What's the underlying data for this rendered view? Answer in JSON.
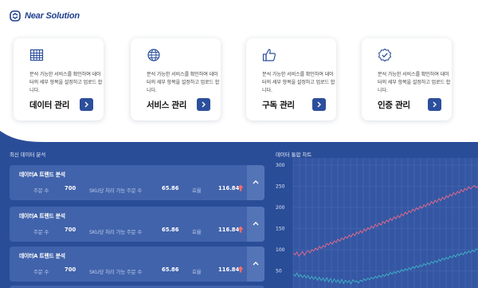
{
  "brand": {
    "name": "Near Solution",
    "color": "#1f3e8f"
  },
  "cards": [
    {
      "icon": "grid-table-icon",
      "description": "분석 가능한 서비스를 확인하여 데이터의 세부 항목을 설정하고 업로드 합니다.",
      "title": "데이터 관리"
    },
    {
      "icon": "globe-icon",
      "description": "분석 가능한 서비스를 확인하여 데이터의 세부 항목을 설정하고 업로드 합니다.",
      "title": "서비스 관리"
    },
    {
      "icon": "thumbs-up-icon",
      "description": "분석 가능한 서비스를 확인하여 데이터의 세부 항목을 설정하고 업로드 합니다.",
      "title": "구독 관리"
    },
    {
      "icon": "badge-check-icon",
      "description": "분석 가능한 서비스를 확인하여 데이터의 세부 항목을 설정하고 업로드 합니다.",
      "title": "인증 관리"
    }
  ],
  "recent": {
    "title": "최신 데이터 분석",
    "rows": [
      {
        "title": "데이터A 트렌드 분석",
        "orders_label": "주문 수",
        "orders": "700",
        "sku_label": "SKU당 처리 가능 주문 수",
        "sku": "65.86",
        "eff_label": "효율",
        "eff": "116.84",
        "trend": "up"
      },
      {
        "title": "데이터A 트렌드 분석",
        "orders_label": "주문 수",
        "orders": "700",
        "sku_label": "SKU당 처리 가능 주문 수",
        "sku": "65.86",
        "eff_label": "효율",
        "eff": "116.84",
        "trend": "up"
      },
      {
        "title": "데이터A 트렌드 분석",
        "orders_label": "주문 수",
        "orders": "700",
        "sku_label": "SKU당 처리 가능 주문 수",
        "sku": "65.86",
        "eff_label": "효율",
        "eff": "116.84",
        "trend": "up"
      }
    ]
  },
  "chart_data": {
    "type": "line",
    "title": "데이터 통합 차트",
    "ylim": [
      0,
      300
    ],
    "yticks": [
      300,
      250,
      200,
      150,
      100,
      50
    ],
    "grid": true,
    "series": [
      {
        "color": "#e86a8c",
        "values": [
          92,
          88,
          95,
          85,
          90,
          96,
          87,
          94,
          98,
          92,
          100,
          97,
          104,
          99,
          108,
          103,
          110,
          106,
          115,
          111,
          118,
          113,
          121,
          117,
          125,
          120,
          128,
          124,
          131,
          127,
          135,
          130,
          138,
          133,
          142,
          137,
          145,
          140,
          149,
          144,
          152,
          148,
          156,
          151,
          160,
          155,
          163,
          158,
          167,
          162,
          170,
          166,
          174,
          169,
          178,
          173,
          181,
          176,
          185,
          180,
          189,
          184,
          192,
          188,
          196,
          191,
          199,
          195,
          203,
          198,
          206,
          202,
          210,
          205,
          214,
          209,
          217,
          212,
          221,
          216,
          224,
          219,
          228,
          223,
          231,
          227,
          235,
          230,
          238,
          234,
          242,
          237,
          245,
          241,
          249,
          244,
          248,
          252,
          247,
          250
        ]
      },
      {
        "color": "#3fb4c9",
        "values": [
          42,
          38,
          45,
          36,
          41,
          34,
          40,
          33,
          39,
          31,
          37,
          30,
          36,
          28,
          35,
          27,
          33,
          25,
          34,
          24,
          32,
          22,
          31,
          23,
          29,
          21,
          30,
          20,
          28,
          22,
          27,
          19,
          29,
          24,
          26,
          21,
          28,
          25,
          31,
          27,
          33,
          29,
          35,
          31,
          37,
          33,
          39,
          35,
          41,
          37,
          43,
          39,
          46,
          42,
          48,
          44,
          50,
          46,
          53,
          49,
          55,
          51,
          57,
          53,
          60,
          56,
          62,
          58,
          64,
          60,
          67,
          63,
          69,
          65,
          72,
          68,
          74,
          70,
          77,
          73,
          80,
          76,
          82,
          78,
          85,
          81,
          87,
          83,
          90,
          86,
          92,
          88,
          95,
          91,
          97,
          93,
          99,
          95,
          102,
          100
        ]
      }
    ]
  }
}
